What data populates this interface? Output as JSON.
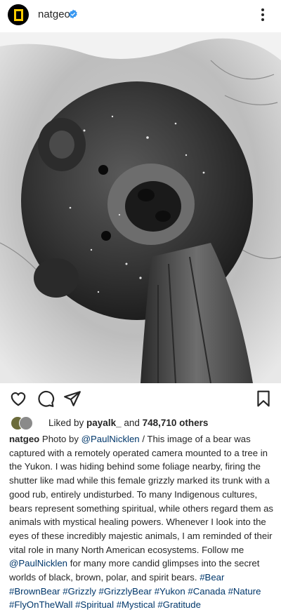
{
  "header": {
    "username": "natgeo",
    "avatar": "national-geographic-logo",
    "verified_color": "#3897f0",
    "more_icon": "more-vertical-icon"
  },
  "photo": {
    "alt_subject": "black and white photograph of a grizzly bear marking a tree trunk in snow"
  },
  "actions": {
    "icons": [
      "heart-icon",
      "comment-icon",
      "share-icon",
      "bookmark-icon"
    ]
  },
  "likes": {
    "prefix": "Liked by ",
    "user": "payalk_",
    "middle": " and ",
    "count": "748,710 others"
  },
  "caption": {
    "username": "natgeo",
    "segments": [
      {
        "text": " Photo by ",
        "link": false
      },
      {
        "text": "@PaulNicklen",
        "link": true
      },
      {
        "text": " / This image of a bear was captured  with a remotely operated camera mounted to a tree in the Yukon. I was hiding behind some foliage nearby, firing the shutter like mad while this female grizzly marked its trunk with a good rub, entirely undisturbed. To many Indigenous cultures, bears represent something spiritual, while others regard them as animals with mystical healing powers. Whenever I look into the eyes of these incredibly majestic animals, I am reminded of their vital role in many North American ecosystems. Follow me ",
        "link": false
      },
      {
        "text": "@PaulNicklen",
        "link": true
      },
      {
        "text": " for many more candid glimpses into the secret worlds of black, brown, polar, and spirit bears. ",
        "link": false
      },
      {
        "text": "#Bear",
        "link": true
      },
      {
        "text": " ",
        "link": false
      },
      {
        "text": "#BrownBear",
        "link": true
      },
      {
        "text": " ",
        "link": false
      },
      {
        "text": "#Grizzly",
        "link": true
      },
      {
        "text": " ",
        "link": false
      },
      {
        "text": "#GrizzlyBear",
        "link": true
      },
      {
        "text": " ",
        "link": false
      },
      {
        "text": "#Yukon",
        "link": true
      },
      {
        "text": " ",
        "link": false
      },
      {
        "text": "#Canada",
        "link": true
      },
      {
        "text": " ",
        "link": false
      },
      {
        "text": "#Nature",
        "link": true
      },
      {
        "text": " ",
        "link": false
      },
      {
        "text": "#FlyOnTheWall",
        "link": true
      },
      {
        "text": " ",
        "link": false
      },
      {
        "text": "#Spiritual",
        "link": true
      },
      {
        "text": " ",
        "link": false
      },
      {
        "text": "#Mystical",
        "link": true
      },
      {
        "text": " ",
        "link": false
      },
      {
        "text": "#Gratitude",
        "link": true
      }
    ]
  }
}
